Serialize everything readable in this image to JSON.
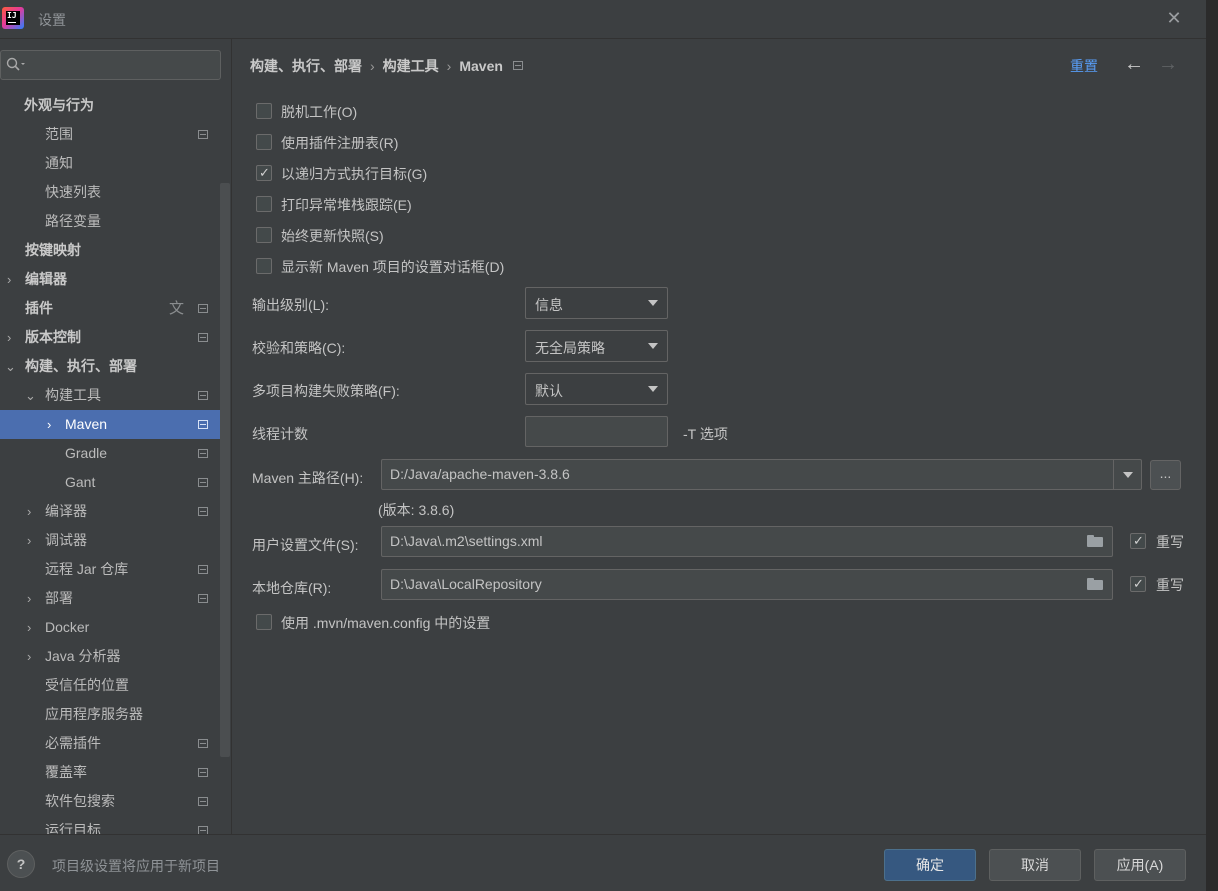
{
  "window": {
    "title": "设置"
  },
  "sidebar": {
    "search_placeholder": "",
    "items": [
      {
        "label": "外观与行为"
      },
      {
        "label": "范围"
      },
      {
        "label": "通知"
      },
      {
        "label": "快速列表"
      },
      {
        "label": "路径变量"
      },
      {
        "label": "按键映射"
      },
      {
        "label": "编辑器"
      },
      {
        "label": "插件"
      },
      {
        "label": "版本控制"
      },
      {
        "label": "构建、执行、部署"
      },
      {
        "label": "构建工具"
      },
      {
        "label": "Maven"
      },
      {
        "label": "Gradle"
      },
      {
        "label": "Gant"
      },
      {
        "label": "编译器"
      },
      {
        "label": "调试器"
      },
      {
        "label": "远程 Jar 仓库"
      },
      {
        "label": "部署"
      },
      {
        "label": "Docker"
      },
      {
        "label": "Java 分析器"
      },
      {
        "label": "受信任的位置"
      },
      {
        "label": "应用程序服务器"
      },
      {
        "label": "必需插件"
      },
      {
        "label": "覆盖率"
      },
      {
        "label": "软件包搜索"
      },
      {
        "label": "运行目标"
      }
    ]
  },
  "breadcrumb": {
    "part1": "构建、执行、部署",
    "part2": "构建工具",
    "part3": "Maven",
    "sep": "›"
  },
  "header": {
    "reset_label": "重置",
    "back_icon": "←",
    "forward_icon": "→"
  },
  "checkboxes": [
    {
      "label": "脱机工作(O)",
      "checked": false
    },
    {
      "label": "使用插件注册表(R)",
      "checked": false
    },
    {
      "label": "以递归方式执行目标(G)",
      "checked": true
    },
    {
      "label": "打印异常堆栈跟踪(E)",
      "checked": false
    },
    {
      "label": "始终更新快照(S)",
      "checked": false
    },
    {
      "label": "显示新 Maven 项目的设置对话框(D)",
      "checked": false
    }
  ],
  "form": {
    "output_level": {
      "label": "输出级别(L):",
      "value": "信息"
    },
    "checksum_policy": {
      "label": "校验和策略(C):",
      "value": "无全局策略"
    },
    "multiproject_fail": {
      "label": "多项目构建失败策略(F):",
      "value": "默认"
    },
    "thread_count": {
      "label": "线程计数",
      "value": "",
      "hint": "-T 选项"
    },
    "maven_home": {
      "label": "Maven 主路径(H):",
      "value": "D:/Java/apache-maven-3.8.6",
      "browse": "...",
      "version": "(版本: 3.8.6)"
    },
    "user_settings": {
      "label": "用户设置文件(S):",
      "value": "D:\\Java\\.m2\\settings.xml",
      "override_label": "重写",
      "override": true
    },
    "local_repo": {
      "label": "本地仓库(R):",
      "value": "D:\\Java\\LocalRepository",
      "override_label": "重写",
      "override": true
    },
    "use_mvn_config": {
      "label": "使用 .mvn/maven.config 中的设置",
      "checked": false
    }
  },
  "footer": {
    "help_label": "?",
    "status_text": "项目级设置将应用于新项目",
    "ok_label": "确定",
    "cancel_label": "取消",
    "apply_label": "应用(A)"
  },
  "colors": {
    "accent": "#4b6eaf",
    "link": "#589df6",
    "primary_button": "#365880",
    "background": "#3c3f41"
  }
}
